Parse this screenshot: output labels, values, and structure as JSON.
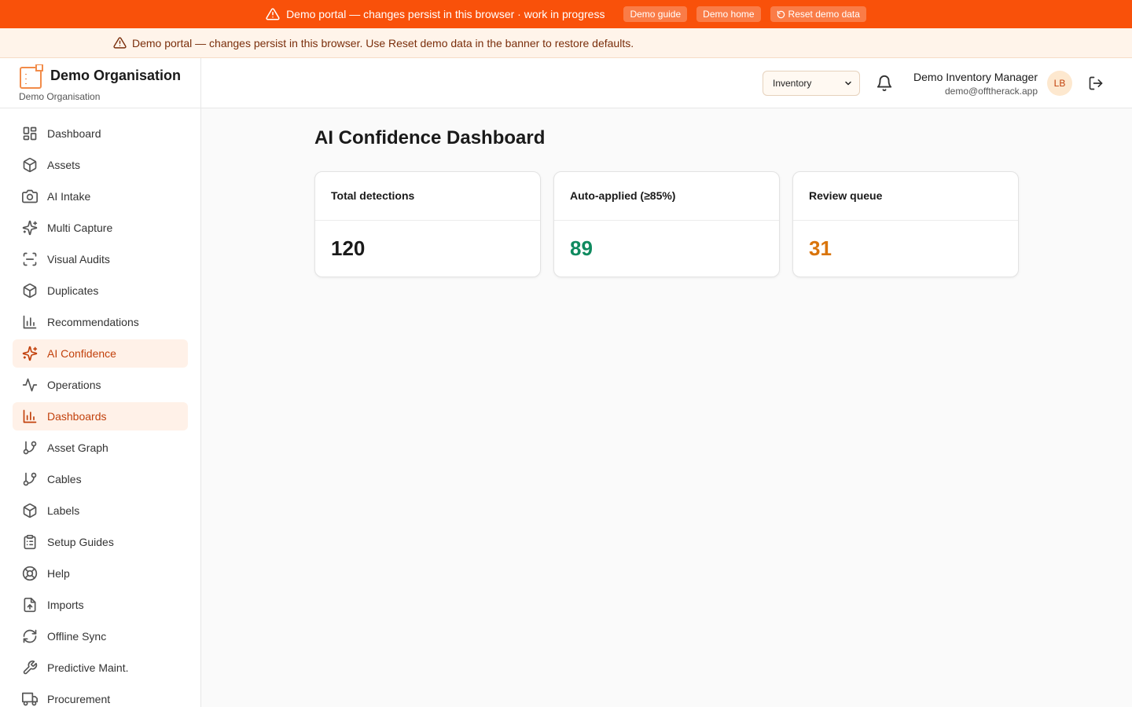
{
  "banner": {
    "message": "Demo portal — changes persist in this browser · work in progress",
    "demo_guide": "Demo guide",
    "demo_home": "Demo home",
    "reset": "Reset demo data"
  },
  "notice": {
    "message": "Demo portal — changes persist in this browser. Use Reset demo data in the banner to restore defaults."
  },
  "brand": {
    "name": "Demo Organisation",
    "subtitle": "Demo Organisation"
  },
  "sidebar": {
    "items": [
      {
        "label": "Dashboard",
        "icon": "grid-icon"
      },
      {
        "label": "Assets",
        "icon": "box-icon"
      },
      {
        "label": "AI Intake",
        "icon": "camera-icon"
      },
      {
        "label": "Multi Capture",
        "icon": "sparkles-icon"
      },
      {
        "label": "Visual Audits",
        "icon": "scan-icon"
      },
      {
        "label": "Duplicates",
        "icon": "box-icon"
      },
      {
        "label": "Recommendations",
        "icon": "bar-chart-icon"
      },
      {
        "label": "AI Confidence",
        "icon": "sparkles-icon",
        "active": true
      },
      {
        "label": "Operations",
        "icon": "activity-icon"
      },
      {
        "label": "Dashboards",
        "icon": "bar-chart-icon",
        "active": true
      },
      {
        "label": "Asset Graph",
        "icon": "git-branch-icon"
      },
      {
        "label": "Cables",
        "icon": "git-branch-icon"
      },
      {
        "label": "Labels",
        "icon": "box-icon"
      },
      {
        "label": "Setup Guides",
        "icon": "clipboard-icon"
      },
      {
        "label": "Help",
        "icon": "life-buoy-icon"
      },
      {
        "label": "Imports",
        "icon": "file-upload-icon"
      },
      {
        "label": "Offline Sync",
        "icon": "refresh-icon"
      },
      {
        "label": "Predictive Maint.",
        "icon": "wrench-icon"
      },
      {
        "label": "Procurement",
        "icon": "truck-icon"
      }
    ]
  },
  "header": {
    "module_selected": "Inventory",
    "user_name": "Demo Inventory Manager",
    "user_email": "demo@offtherack.app",
    "avatar_initials": "LB"
  },
  "main": {
    "title": "AI Confidence Dashboard",
    "cards": [
      {
        "label": "Total detections",
        "value": "120",
        "color": "#1a1a1a"
      },
      {
        "label": "Auto-applied (≥85%)",
        "value": "89",
        "color": "#0f8a5f"
      },
      {
        "label": "Review queue",
        "value": "31",
        "color": "#d9740b"
      }
    ]
  },
  "colors": {
    "banner": "#f9510a",
    "accent": "#c2410c",
    "active_bg": "#fff1e8"
  }
}
